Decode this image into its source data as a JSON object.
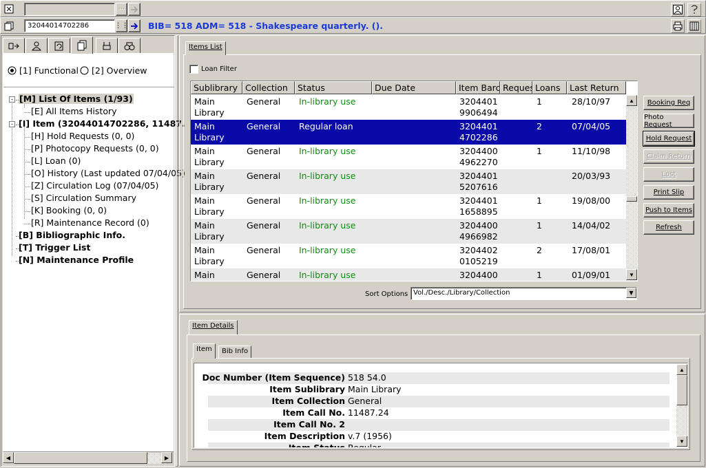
{
  "toolbar_top": {
    "disabled_field": "",
    "barcode_field": "32044014702286",
    "record_info": "BIB= 518 ADM= 518 - Shakespeare quarterly. ()."
  },
  "left_panel": {
    "tab_icons": [
      "circulation-tab-icon",
      "patron-tab-icon",
      "loans-tab-icon",
      "items-tab-icon",
      "requests-tab-icon",
      "search-tab-icon"
    ],
    "view_options": [
      "[1] Functional",
      "[2] Overview"
    ],
    "selected_view": 0,
    "tree": [
      {
        "label": "[M] List Of Items (1/93)",
        "bold": true,
        "level": 0,
        "expander": "-",
        "selected": true
      },
      {
        "label": "[E] All Items History",
        "bold": false,
        "level": 1
      },
      {
        "label": "[I] Item (32044014702286, 11487.",
        "bold": true,
        "level": 0,
        "expander": "-"
      },
      {
        "label": "[H] Hold Requests (0, 0)",
        "bold": false,
        "level": 1
      },
      {
        "label": "[P] Photocopy Requests (0, 0)",
        "bold": false,
        "level": 1
      },
      {
        "label": "[L] Loan (0)",
        "bold": false,
        "level": 1
      },
      {
        "label": "[O] History (Last updated 07/04/05)",
        "bold": false,
        "level": 1
      },
      {
        "label": "[Z] Circulation Log (07/04/05)",
        "bold": false,
        "level": 1
      },
      {
        "label": "[S] Circulation Summary",
        "bold": false,
        "level": 1
      },
      {
        "label": "[K] Booking (0, 0)",
        "bold": false,
        "level": 1
      },
      {
        "label": "[R] Maintenance Record (0)",
        "bold": false,
        "level": 1
      },
      {
        "label": "[B] Bibliographic Info.",
        "bold": true,
        "level": 0
      },
      {
        "label": "[T] Trigger List",
        "bold": true,
        "level": 0
      },
      {
        "label": "[N] Maintenance Profile",
        "bold": true,
        "level": 0
      }
    ]
  },
  "items_list": {
    "tab_label": "Items List",
    "loan_filter_label": "Loan Filter",
    "loan_filter_checked": false,
    "columns": [
      "Sublibrary",
      "Collection",
      "Status",
      "Due Date",
      "Item Barco",
      "Reques",
      "Loans",
      "Last Return"
    ],
    "rows": [
      {
        "sublibrary": "Main\nLibrary",
        "collection": "General",
        "status": "In-library use",
        "due_date": "",
        "barcode": "3204401\n9906494",
        "requests": "",
        "loans": "1",
        "last_return": "28/10/97",
        "status_color": "green"
      },
      {
        "sublibrary": "Main\nLibrary",
        "collection": "General",
        "status": "Regular loan",
        "due_date": "",
        "barcode": "3204401\n4702286",
        "requests": "",
        "loans": "2",
        "last_return": "07/04/05",
        "status_color": "black"
      },
      {
        "sublibrary": "Main\nLibrary",
        "collection": "General",
        "status": "In-library use",
        "due_date": "",
        "barcode": "3204400\n4962270",
        "requests": "",
        "loans": "1",
        "last_return": "11/10/98",
        "status_color": "green"
      },
      {
        "sublibrary": "Main\nLibrary",
        "collection": "General",
        "status": "In-library use",
        "due_date": "",
        "barcode": "3204401\n5207616",
        "requests": "",
        "loans": "",
        "last_return": "20/03/93",
        "status_color": "green"
      },
      {
        "sublibrary": "Main\nLibrary",
        "collection": "General",
        "status": "In-library use",
        "due_date": "",
        "barcode": "3204401\n1658895",
        "requests": "",
        "loans": "1",
        "last_return": "19/08/00",
        "status_color": "green"
      },
      {
        "sublibrary": "Main\nLibrary",
        "collection": "General",
        "status": "In-library use",
        "due_date": "",
        "barcode": "3204400\n4966982",
        "requests": "",
        "loans": "1",
        "last_return": "14/04/02",
        "status_color": "green"
      },
      {
        "sublibrary": "Main\nLibrary",
        "collection": "General",
        "status": "In-library use",
        "due_date": "",
        "barcode": "3204402\n0105219",
        "requests": "",
        "loans": "2",
        "last_return": "17/08/01",
        "status_color": "green"
      },
      {
        "sublibrary": "Main",
        "collection": "General",
        "status": "In-library use",
        "due_date": "",
        "barcode": "3204400",
        "requests": "",
        "loans": "1",
        "last_return": "01/09/01",
        "status_color": "green"
      }
    ],
    "selected_row": 1,
    "sort_label": "Sort Options",
    "sort_value": "Vol./Desc./Library/Collection",
    "buttons": [
      {
        "label": "Booking Req",
        "accel": "B",
        "disabled": false,
        "default": false
      },
      {
        "label": "Photo Request",
        "accel": "",
        "disabled": false,
        "default": false
      },
      {
        "label": "Hold Request",
        "accel": "H",
        "disabled": false,
        "default": true
      },
      {
        "label": "Claim Return",
        "accel": "C",
        "disabled": true,
        "default": false
      },
      {
        "label": "Lost",
        "accel": "L",
        "disabled": true,
        "default": false
      },
      {
        "label": "Print Slip",
        "accel": "P",
        "disabled": false,
        "default": false
      },
      {
        "label": "Push to Items",
        "accel": "I",
        "disabled": false,
        "default": false
      },
      {
        "label": "Refresh",
        "accel": "R",
        "disabled": false,
        "default": false
      }
    ]
  },
  "item_details": {
    "tab_label": "Item Details",
    "sub_tabs": [
      "Item",
      "Bib Info"
    ],
    "active_sub_tab": 0,
    "fields": [
      {
        "label": "Doc Number (Item Sequence)",
        "value": "518 54.0"
      },
      {
        "label": "Item Sublibrary",
        "value": "Main Library"
      },
      {
        "label": "Item Collection",
        "value": "General"
      },
      {
        "label": "Item Call No.",
        "value": "11487.24"
      },
      {
        "label": "Item Call No. 2",
        "value": ""
      },
      {
        "label": "Item Description",
        "value": "v.7 (1956)"
      },
      {
        "label": "Item Status",
        "value": "Regular"
      }
    ]
  },
  "colors": {
    "selection": "#0a0aa8",
    "status_green": "#0d8f0d",
    "record_info_blue": "#1a3ad8"
  }
}
